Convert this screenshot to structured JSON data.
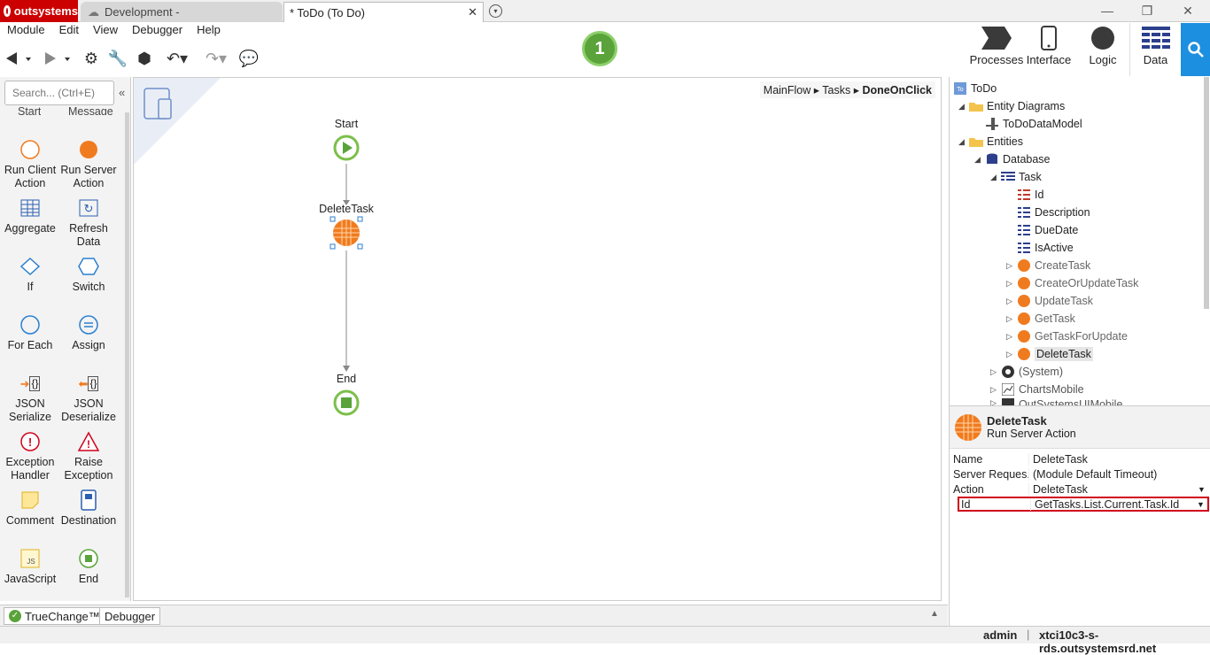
{
  "tabs": {
    "outsystems": "outsystems",
    "development": "Development -",
    "todo": "* ToDo (To Do)",
    "close": "✕",
    "more": "▾"
  },
  "window": {
    "minimize": "—",
    "restore": "❐",
    "close": "✕"
  },
  "menu": [
    "Module",
    "Edit",
    "View",
    "Debugger",
    "Help"
  ],
  "badge": "1",
  "right_tabs": {
    "processes": "Processes",
    "interface": "Interface",
    "logic": "Logic",
    "data": "Data"
  },
  "toolbox": {
    "search_placeholder": "Search... (Ctrl+E)",
    "top_labels": [
      "Start",
      "Message"
    ],
    "tools": [
      [
        "Run Client\nAction",
        "Run Server\nAction"
      ],
      [
        "Aggregate",
        "Refresh\nData"
      ],
      [
        "If",
        "Switch"
      ],
      [
        "For Each",
        "Assign"
      ],
      [
        "JSON\nSerialize",
        "JSON\nDeserialize"
      ],
      [
        "Exception\nHandler",
        "Raise\nException"
      ],
      [
        "Comment",
        "Destination"
      ],
      [
        "JavaScript",
        "End"
      ]
    ]
  },
  "breadcrumb": {
    "a": "MainFlow",
    "b": "Tasks",
    "c": "DoneOnClick",
    "sep": "▸"
  },
  "flow": {
    "start": "Start",
    "delete": "DeleteTask",
    "end": "End"
  },
  "bottom": {
    "truechange": "TrueChange™",
    "debugger": "Debugger"
  },
  "status": {
    "user": "admin",
    "server": "xtci10c3-s-rds.outsystemsrd.net"
  },
  "tree": [
    "ToDo",
    "Entity Diagrams",
    "ToDoDataModel",
    "Entities",
    "Database",
    "Task",
    "Id",
    "Description",
    "DueDate",
    "IsActive",
    "CreateTask",
    "CreateOrUpdateTask",
    "UpdateTask",
    "GetTask",
    "GetTaskForUpdate",
    "DeleteTask",
    "(System)",
    "ChartsMobile",
    "OutSystemsUIMobile"
  ],
  "props": {
    "title": "DeleteTask",
    "subtitle": "Run Server Action",
    "rows": [
      {
        "k": "Name",
        "v": "DeleteTask"
      },
      {
        "k": "Server Reques...",
        "v": "(Module Default Timeout)"
      },
      {
        "k": "Action",
        "v": "DeleteTask"
      },
      {
        "k": "Id",
        "v": "GetTasks.List.Current.Task.Id"
      }
    ]
  },
  "colors": {
    "accent": "#1d8fe0",
    "brand": "#cc0000",
    "node_orange": "#f07b1f",
    "start_green": "#5aa33a",
    "highlight": "#d0021b"
  }
}
